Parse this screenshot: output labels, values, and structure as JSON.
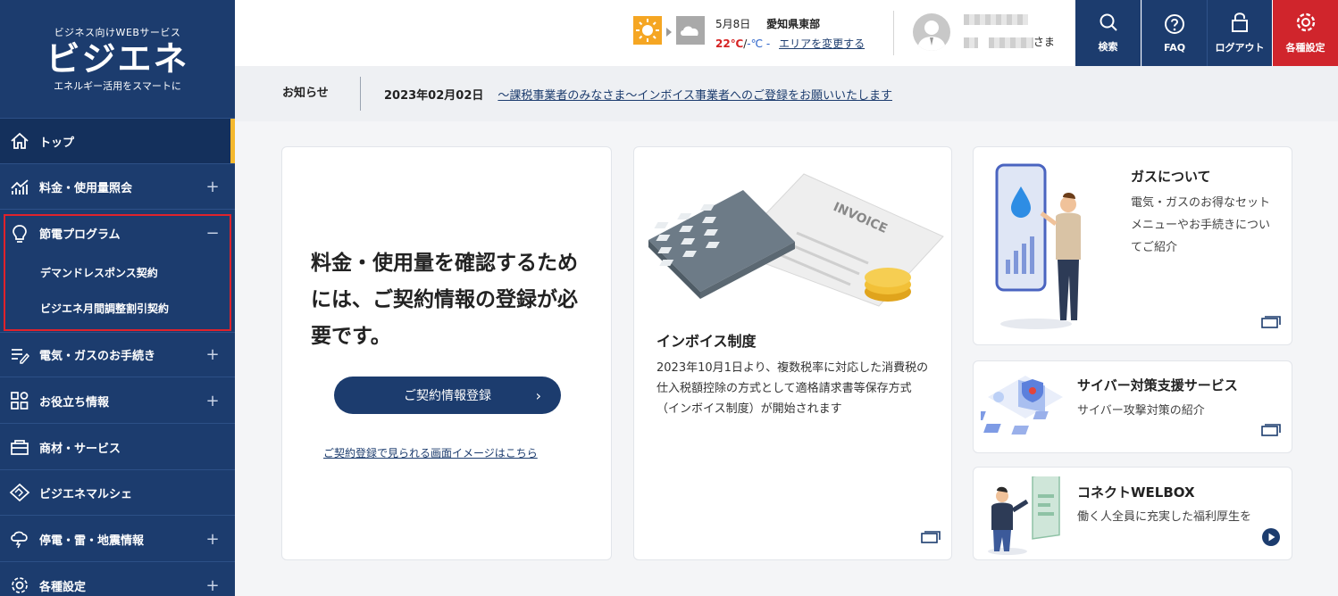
{
  "brand": {
    "tagline": "ビジネス向けWEBサービス",
    "name": "ビジエネ",
    "subtitle": "エネルギー活用をスマートに"
  },
  "sidebar": {
    "items": [
      {
        "label": "トップ",
        "icon": "home-icon",
        "toggle": ""
      },
      {
        "label": "料金・使用量照会",
        "icon": "chart-icon",
        "toggle": "+"
      },
      {
        "label": "節電プログラム",
        "icon": "bulb-icon",
        "toggle": "−"
      },
      {
        "label": "電気・ガスのお手続き",
        "icon": "form-icon",
        "toggle": "+"
      },
      {
        "label": "お役立ち情報",
        "icon": "grid-icon",
        "toggle": "+"
      },
      {
        "label": "商材・サービス",
        "icon": "store-icon",
        "toggle": ""
      },
      {
        "label": "ビジエネマルシェ",
        "icon": "handshake-icon",
        "toggle": ""
      },
      {
        "label": "停電・雷・地震情報",
        "icon": "storm-icon",
        "toggle": "+"
      },
      {
        "label": "各種設定",
        "icon": "gear-icon",
        "toggle": "+"
      }
    ],
    "sub_items": [
      "デマンドレスポンス契約",
      "ビジエネ月間調整割引契約"
    ]
  },
  "header": {
    "date": "5月8日",
    "region": "愛知県東部",
    "temp_high": "22℃",
    "temp_sep": "/",
    "temp_low": "-℃ -",
    "area_link": "エリアを変更する",
    "user_suffix": "さま",
    "buttons": [
      {
        "label": "検索",
        "icon": "search-icon",
        "color": "#1c3c6e"
      },
      {
        "label": "FAQ",
        "icon": "question-icon",
        "color": "#1c3c6e"
      },
      {
        "label": "ログアウト",
        "icon": "lock-icon",
        "color": "#1c3c6e"
      },
      {
        "label": "各種設定",
        "icon": "gear-icon",
        "color": "#d0252c"
      }
    ]
  },
  "notice": {
    "label": "お知らせ",
    "date": "2023年02月02日",
    "text": "～課税事業者のみなさま～インボイス事業者へのご登録をお願いいたします"
  },
  "cards": {
    "contract": {
      "title": "料金・使用量を確認するためには、ご契約情報の登録が必要です。",
      "button": "ご契約情報登録",
      "link": "ご契約登録で見られる画面イメージはこちら"
    },
    "invoice": {
      "image_label": "INVOICE",
      "title": "インボイス制度",
      "body": "2023年10月1日より、複数税率に対応した消費税の仕入税額控除の方式として適格請求書等保存方式（インボイス制度）が開始されます"
    },
    "gas": {
      "title": "ガスについて",
      "desc": "電気・ガスのお得なセットメニューやお手続きについてご紹介"
    },
    "cyber": {
      "title": "サイバー対策支援サービス",
      "desc": "サイバー攻撃対策の紹介"
    },
    "welbox": {
      "title": "コネクトWELBOX",
      "desc": "働く人全員に充実した福利厚生を"
    }
  },
  "colors": {
    "navy": "#1c3c6e",
    "red": "#d0252c",
    "accent": "#f5b82e"
  }
}
